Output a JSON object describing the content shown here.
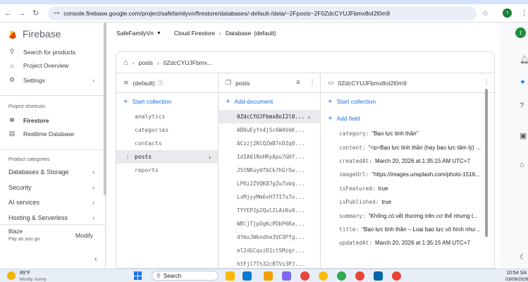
{
  "browser": {
    "url": "console.firebase.google.com/project/safefamilyvn/firestore/databases/-default-/data/~2Fposts~2F0ZdcCYUJFbmx8oI2l0m9",
    "profile_initial": "t"
  },
  "sidebar": {
    "brand": "Firebase",
    "search_label": "Search for products",
    "overview_label": "Project Overview",
    "settings_label": "Settings",
    "shortcuts_heading": "Project shortcuts",
    "firestore_label": "Firestore",
    "realtime_label": "Realtime Database",
    "categories_heading": "Product categories",
    "categories": [
      "Databases & Storage",
      "Security",
      "AI services",
      "Hosting & Serverless"
    ],
    "plan_name": "Blaze",
    "plan_sub": "Pay as you go",
    "modify_label": "Modify"
  },
  "header": {
    "project": "SafeFamilyVn",
    "service": "Cloud Firestore",
    "database": "Database",
    "database_name": "(default)",
    "avatar_initial": "t"
  },
  "panel": {
    "path": [
      "posts",
      "0ZdcCYUJFbmx..."
    ],
    "db_label": "(default)",
    "start_collection_label": "Start collection",
    "collections": [
      "analytics",
      "categories",
      "contacts",
      "posts",
      "reports"
    ],
    "active_collection": "posts",
    "docs_header": "posts",
    "add_document_label": "Add document",
    "documents": [
      "0ZdcCYUJFbmx8oI2l0...",
      "AB0uEyfn4j5c6W4VeK...",
      "ACzzj2NlQZmB7nDZq0...",
      "IdIA01NxHRyApu7GH7...",
      "J5tNKuy0fbCk7hGr5w...",
      "LP0z2ZVQK87gZw7obq...",
      "LxMjyyMm6vH77I7x7o...",
      "TYYEP2p2Qul2LAiKu0...",
      "WBljTjpOgKcPDbP6Ra...",
      "d7mxJWkndhe3VCOPfg...",
      "el2dGCqxzD1ctSMzqr...",
      "htFjl7Th32cBTVs3PJ..."
    ],
    "doc_header": "0ZdcCYUJFbmx8oI2l0m9",
    "add_field_label": "Add field",
    "fields": [
      {
        "key": "category:",
        "value": "\"Bạo lực tinh thần\""
      },
      {
        "key": "content:",
        "value": "\"<p>Bạo lực tinh thần (hay bạo lực tâm lý) ..."
      },
      {
        "key": "createdAt:",
        "value": "March 20, 2026 at 1:35:15 AM UTC+7"
      },
      {
        "key": "imageUrl:",
        "value": "\"https://images.unsplash.com/photo-1516..."
      },
      {
        "key": "isFeatured:",
        "value": "true"
      },
      {
        "key": "isPublished:",
        "value": "true"
      },
      {
        "key": "summary:",
        "value": "\"Không có vết thương trên cơ thể nhưng t..."
      },
      {
        "key": "title:",
        "value": "\"Bạo lực tinh thần – Loại bạo lực vô hình như..."
      },
      {
        "key": "updatedAt:",
        "value": "March 20, 2026 at 1:35:15 AM UTC+7"
      }
    ]
  },
  "taskbar": {
    "temp": "89°F",
    "weather": "Mostly sunny",
    "search_label": "Search",
    "time": "10:54 SA",
    "date": "03/09/2026"
  },
  "colors": {
    "accent": "#1a73e8",
    "firebase_orange": "#ff9100",
    "selected_bg": "#e8eaed"
  }
}
